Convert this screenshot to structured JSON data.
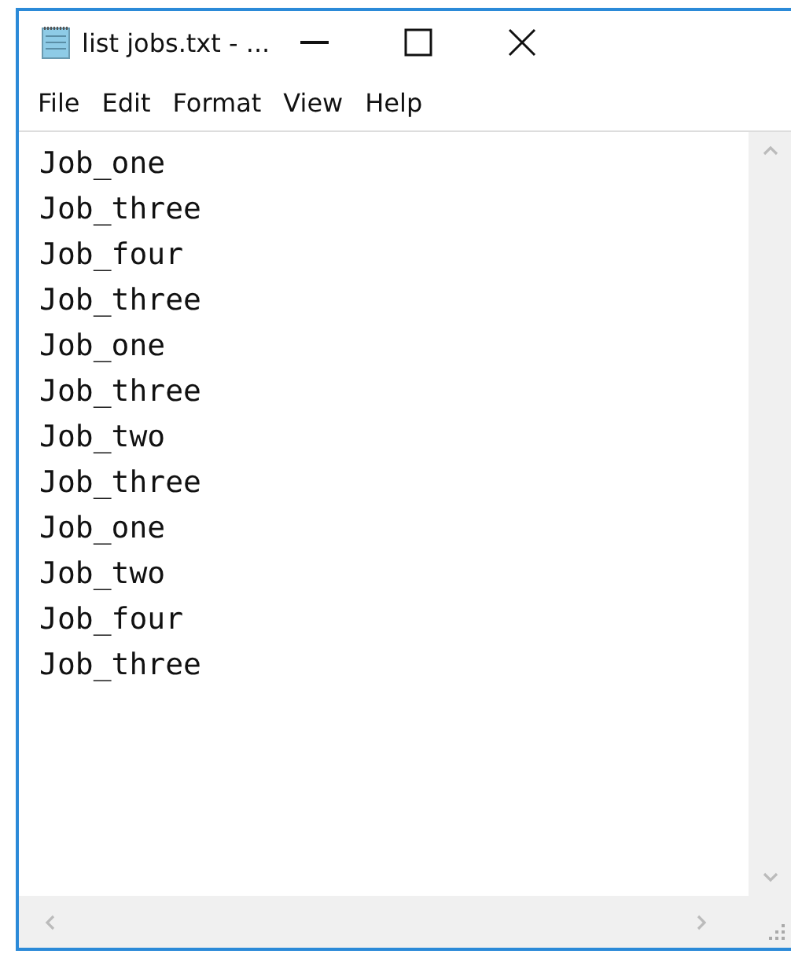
{
  "window": {
    "title": "list jobs.txt - ..."
  },
  "menu": [
    "File",
    "Edit",
    "Format",
    "View",
    "Help"
  ],
  "lines": [
    "Job_one",
    "Job_three",
    "Job_four",
    "Job_three",
    "Job_one",
    "Job_three",
    "Job_two",
    "Job_three",
    "Job_one",
    "Job_two",
    "Job_four",
    "Job_three"
  ]
}
